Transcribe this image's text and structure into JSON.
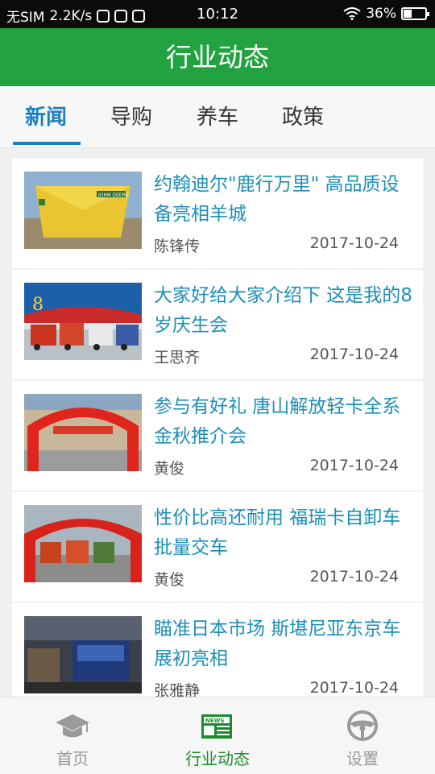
{
  "status_bar": {
    "carrier": "无SIM",
    "net_speed": "2.2K/s",
    "time": "10:12",
    "battery": "36%",
    "battery_level": 0.36
  },
  "app_bar": {
    "title": "行业动态"
  },
  "tabs": [
    {
      "label": "新闻",
      "active": true
    },
    {
      "label": "导购",
      "active": false
    },
    {
      "label": "养车",
      "active": false
    },
    {
      "label": "政策",
      "active": false
    }
  ],
  "news": [
    {
      "title": "约翰迪尔\"鹿行万里\" 高品质设备亮相羊城",
      "author": "陈锋传",
      "date": "2017-10-24",
      "thumb_sign": "JOHN DEERE"
    },
    {
      "title": "大家好给大家介绍下 这是我的8岁庆生会",
      "author": "王思齐",
      "date": "2017-10-24",
      "thumb_sign": "8"
    },
    {
      "title": "参与有好礼 唐山解放轻卡全系金秋推介会",
      "author": "黄俊",
      "date": "2017-10-24",
      "thumb_sign": ""
    },
    {
      "title": "性价比高还耐用 福瑞卡自卸车批量交车",
      "author": "黄俊",
      "date": "2017-10-24",
      "thumb_sign": ""
    },
    {
      "title": "瞄准日本市场 斯堪尼亚东京车展初亮相",
      "author": "张雅静",
      "date": "2017-10-24",
      "thumb_sign": ""
    }
  ],
  "bottom_nav": [
    {
      "label": "首页",
      "icon": "graduation-cap-icon",
      "active": false
    },
    {
      "label": "行业动态",
      "icon": "news-icon",
      "active": true
    },
    {
      "label": "设置",
      "icon": "steering-wheel-icon",
      "active": false
    }
  ],
  "colors": {
    "primary_green": "#22a33f",
    "tab_active_blue": "#1b7fc4",
    "title_blue": "#1d8fb8"
  }
}
